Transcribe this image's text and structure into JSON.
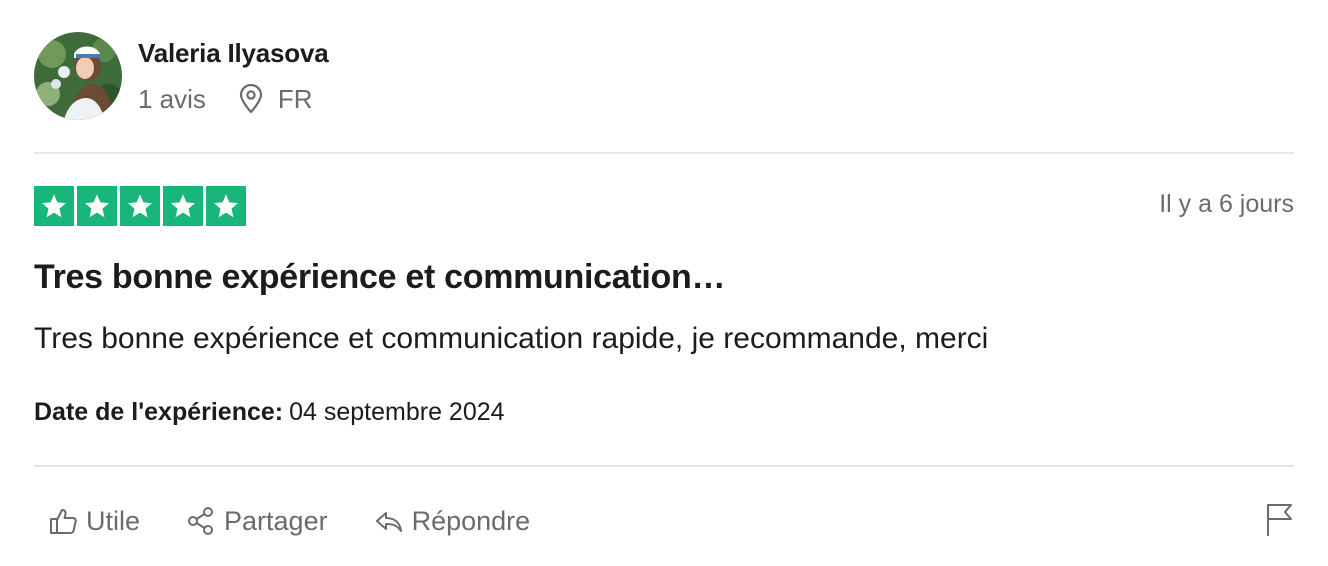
{
  "reviewer": {
    "name": "Valeria Ilyasova",
    "reviews_count": "1 avis",
    "country": "FR",
    "avatar_icon": "profile-photo"
  },
  "review": {
    "rating": 5,
    "rating_max": 5,
    "star_color": "#19b67b",
    "relative_date": "Il y a 6 jours",
    "title": "Tres bonne expérience et communication…",
    "body": "Tres bonne expérience et communication rapide, je recommande, merci",
    "experience_label": "Date de l'expérience:",
    "experience_date": "04 septembre 2024"
  },
  "actions": {
    "useful": "Utile",
    "share": "Partager",
    "reply": "Répondre",
    "report_icon": "flag-icon"
  }
}
